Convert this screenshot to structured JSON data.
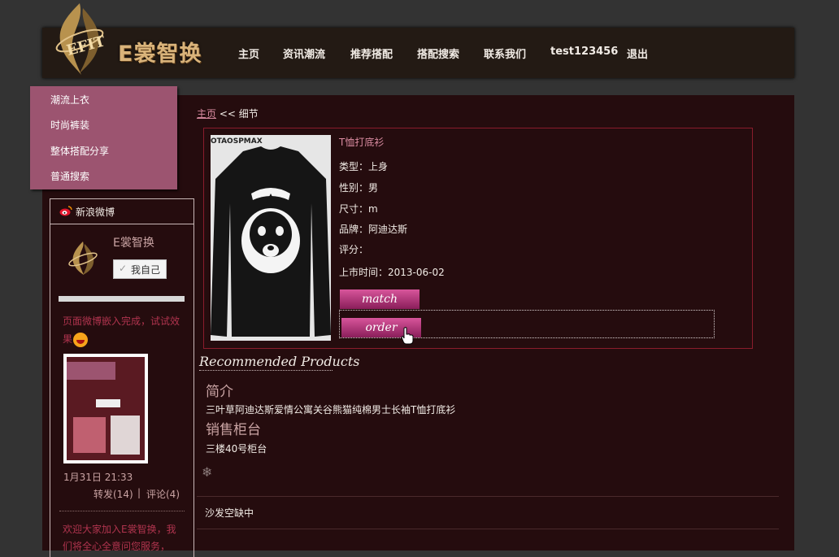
{
  "brand": {
    "emblem_text": "EFIT",
    "name": "E裳智换"
  },
  "nav": [
    "主页",
    "资讯潮流",
    "推荐搭配",
    "搭配搜索",
    "联系我们",
    "test123456",
    "退出"
  ],
  "dropdown": [
    "潮流上衣",
    "时尚裤装",
    "整体搭配分享",
    "普通搜索"
  ],
  "weibo": {
    "title": "新浪微博",
    "account_name": "E裳智换",
    "self_button": "我自己",
    "post_text": "页面微博嵌入完成，试试效果",
    "post_time": "1月31日 21:33",
    "repost": "转发(14)",
    "separator": "|",
    "comment": "评论(4)",
    "welcome": "欢迎大家加入E裳智换，我们将全心全意问您服务，"
  },
  "breadcrumb": {
    "home": "主页",
    "current": "<< 细节"
  },
  "product": {
    "image_brand": "OTAOSPMAX",
    "title": "T恤打底衫",
    "fields": [
      "类型：上身",
      "性别：男",
      "尺寸：m",
      "品牌：阿迪达斯",
      "评分：",
      "上市时间：2013-06-02"
    ],
    "match_button": "match",
    "order_button": "order"
  },
  "recommended_title": "Recommended Products",
  "intro": {
    "title": "简介",
    "text": "三叶草阿迪达斯爱情公寓关谷熊猫纯棉男士长袖T恤打底衫"
  },
  "counter": {
    "title": "销售柜台",
    "text": "三楼40号柜台"
  },
  "comments_empty": "沙发空缺中",
  "colors": {
    "page_bg": "#333333",
    "content_bg": "#250c0e",
    "header_bg": "#231a14",
    "menu_bg": "#9c5470",
    "accent": "#d8559b"
  }
}
